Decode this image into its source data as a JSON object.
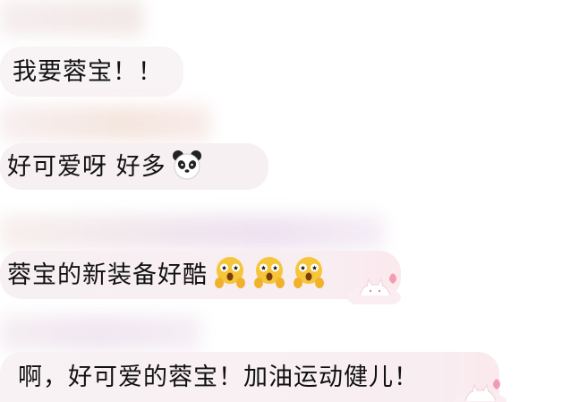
{
  "messages": [
    {
      "text": "我要蓉宝！！",
      "emojis": []
    },
    {
      "text": "好可爱呀 好多",
      "emojis": [
        "panda-face-icon"
      ]
    },
    {
      "text": "蓉宝的新装备好酷",
      "emojis": [
        "starstruck-face-icon",
        "starstruck-face-icon",
        "starstruck-face-icon"
      ]
    },
    {
      "text": "啊，好可爱的蓉宝！加油运动健儿！",
      "emojis": []
    }
  ],
  "colors": {
    "bubble": "#f7f1f3",
    "bubble_pink_tint": "#fbe9ee",
    "text": "#111111",
    "emoji_yellow": "#f6c53a"
  }
}
